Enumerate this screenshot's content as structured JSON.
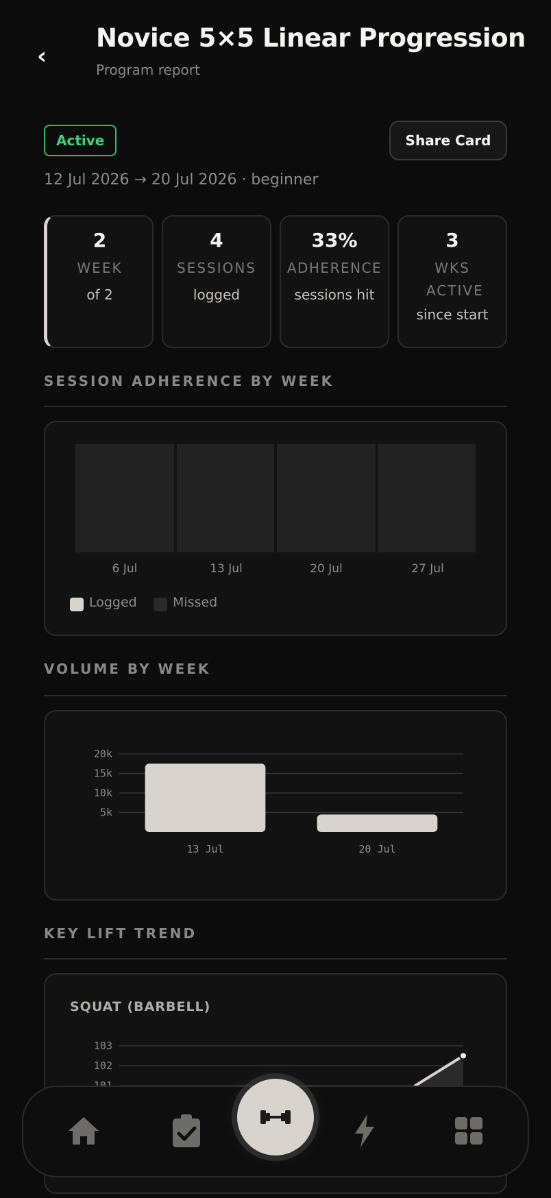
{
  "header": {
    "back_label": "‹",
    "title": "Novice 5×5 Linear Progression",
    "subtitle": "Program report"
  },
  "status": {
    "badge": "Active",
    "badge_color": "#2fbf6a",
    "share_label": "Share Card"
  },
  "dates": "12 Jul 2026 → 20 Jul 2026 · beginner",
  "stats": [
    {
      "value": "2",
      "label": "WEEK",
      "sub": "of 2"
    },
    {
      "value": "4",
      "label": "SESSIONS",
      "sub": "logged"
    },
    {
      "value": "33%",
      "label": "ADHERENCE",
      "sub": "sessions hit"
    },
    {
      "value": "3",
      "label": "WKS ACTIVE",
      "sub": "since start"
    }
  ],
  "adherence": {
    "heading": "SESSION ADHERENCE BY WEEK",
    "weeks": [
      "6 Jul",
      "13 Jul",
      "20 Jul",
      "27 Jul"
    ],
    "legend": {
      "logged": "Logged",
      "missed": "Missed"
    },
    "colors": {
      "logged": "#d8d3cc",
      "missed": "#2a2a2a"
    }
  },
  "volume": {
    "heading": "VOLUME BY WEEK"
  },
  "lift": {
    "heading": "KEY LIFT TREND",
    "name": "SQUAT (BARBELL)"
  },
  "chart_data": [
    {
      "type": "bar",
      "categories": [
        "13 Jul",
        "20 Jul"
      ],
      "values": [
        17500,
        4500
      ],
      "yticks": [
        "5k",
        "10k",
        "15k",
        "20k"
      ],
      "ylim": [
        0,
        20000
      ],
      "grid": true
    },
    {
      "type": "line",
      "yticks": [
        "101",
        "102",
        "103"
      ],
      "ylim": [
        100,
        103
      ],
      "x": [
        0,
        1
      ],
      "values": [
        101,
        102.5
      ],
      "grid": true
    }
  ],
  "nav": {
    "items": [
      "home-icon",
      "clipboard-check-icon",
      "dumbbell-icon",
      "lightning-icon",
      "grid-icon"
    ]
  }
}
